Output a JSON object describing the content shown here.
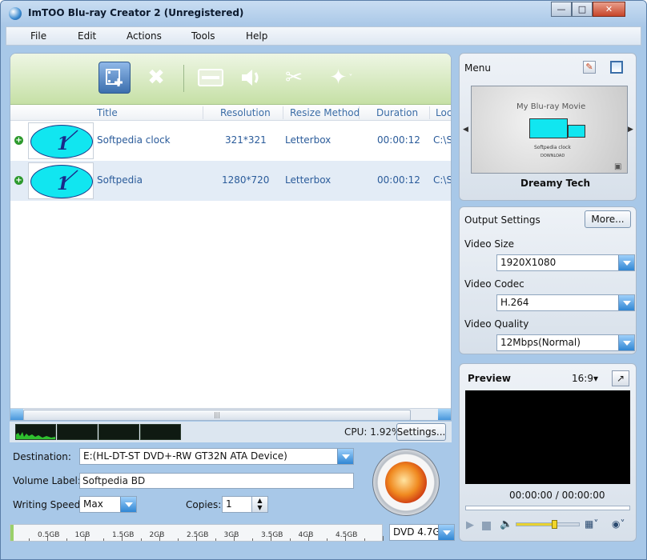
{
  "window": {
    "title": "ImTOO Blu-ray Creator 2 (Unregistered)"
  },
  "menubar": [
    "File",
    "Edit",
    "Actions",
    "Tools",
    "Help"
  ],
  "table": {
    "columns": [
      "Title",
      "Resolution",
      "Resize Method",
      "Duration",
      "Loc"
    ],
    "rows": [
      {
        "title": "Softpedia clock",
        "resolution": "321*321",
        "resize": "Letterbox",
        "duration": "00:00:12",
        "location": "C:\\S"
      },
      {
        "title": "Softpedia",
        "resolution": "1280*720",
        "resize": "Letterbox",
        "duration": "00:00:12",
        "location": "C:\\S"
      }
    ]
  },
  "cpu": {
    "label": "CPU: 1.92%",
    "settings_button": "Settings..."
  },
  "form": {
    "destination_label": "Destination:",
    "destination_value": "E:(HL-DT-ST DVD+-RW GT32N ATA Device)",
    "volume_label": "Volume Label:",
    "volume_value": "Softpedia BD",
    "speed_label": "Writing Speed:",
    "speed_value": "Max",
    "copies_label": "Copies:",
    "copies_value": "1"
  },
  "capacity": {
    "ticks": [
      "0.5GB",
      "1GB",
      "1.5GB",
      "2GB",
      "2.5GB",
      "3GB",
      "3.5GB",
      "4GB",
      "4.5GB"
    ],
    "disc_type": "DVD 4.7G"
  },
  "menu_panel": {
    "title": "Menu",
    "thumb_heading": "My Blu-ray Movie",
    "thumb_caption": "Softpedia clock",
    "thumb_sub": "DOWNLOAD",
    "template_name": "Dreamy Tech"
  },
  "output_settings": {
    "title": "Output Settings",
    "more_button": "More...",
    "video_size_label": "Video Size",
    "video_size_value": "1920X1080",
    "video_codec_label": "Video Codec",
    "video_codec_value": "H.264",
    "video_quality_label": "Video Quality",
    "video_quality_value": "12Mbps(Normal)"
  },
  "preview": {
    "title": "Preview",
    "aspect": "16:9",
    "time": "00:00:00 / 00:00:00"
  }
}
